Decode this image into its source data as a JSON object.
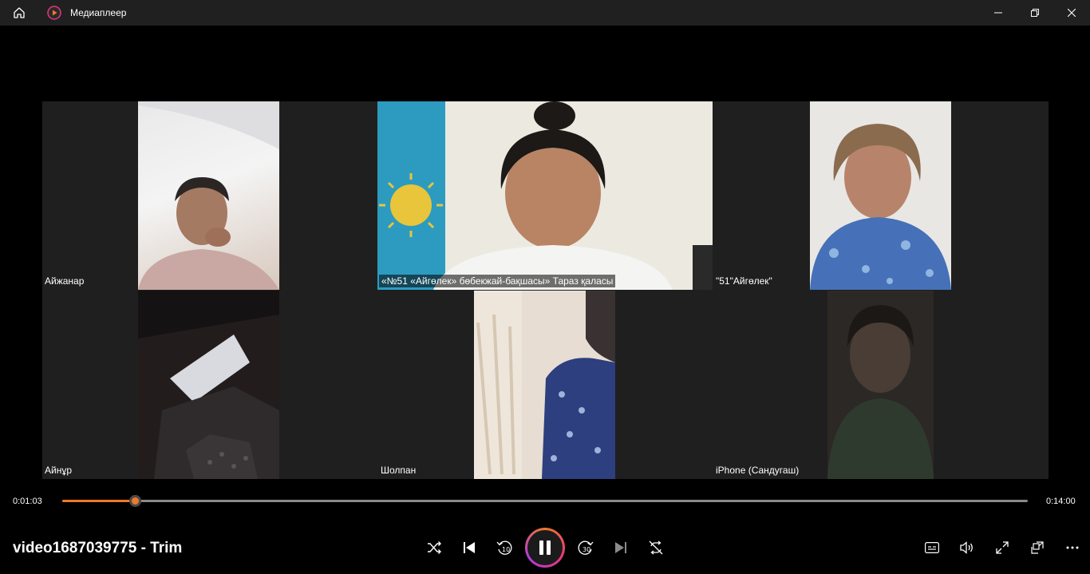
{
  "titlebar": {
    "app_name": "Медиаплеер",
    "icons": [
      "home-icon",
      "media-player-app-icon",
      "minimize-icon",
      "maximize-icon",
      "close-icon"
    ]
  },
  "video": {
    "participants": [
      {
        "name": "Айжанар"
      },
      {
        "name": "«№51 «Айгөлек» бөбекжай-бақшасы» Тараз қаласы"
      },
      {
        "name": "\"51\"Айгөлек\""
      },
      {
        "name": "Айнұр"
      },
      {
        "name": "Шолпан"
      },
      {
        "name": "iPhone (Сандугаш)"
      }
    ]
  },
  "seek": {
    "elapsed": "0:01:03",
    "total": "0:14:00",
    "progress": 0.075
  },
  "controls": {
    "media_title": "video1687039775 - Trim",
    "icons": [
      "shuffle-icon",
      "previous-icon",
      "rewind-10-icon",
      "pause-icon",
      "forward-30-icon",
      "next-icon",
      "repeat-icon",
      "captions-icon",
      "volume-icon",
      "fullscreen-icon",
      "mini-player-icon",
      "more-icon"
    ]
  },
  "colors": {
    "accent": "#f0772b",
    "titlebar_bg": "#202020",
    "tile_bg": "#1f1f1f"
  }
}
